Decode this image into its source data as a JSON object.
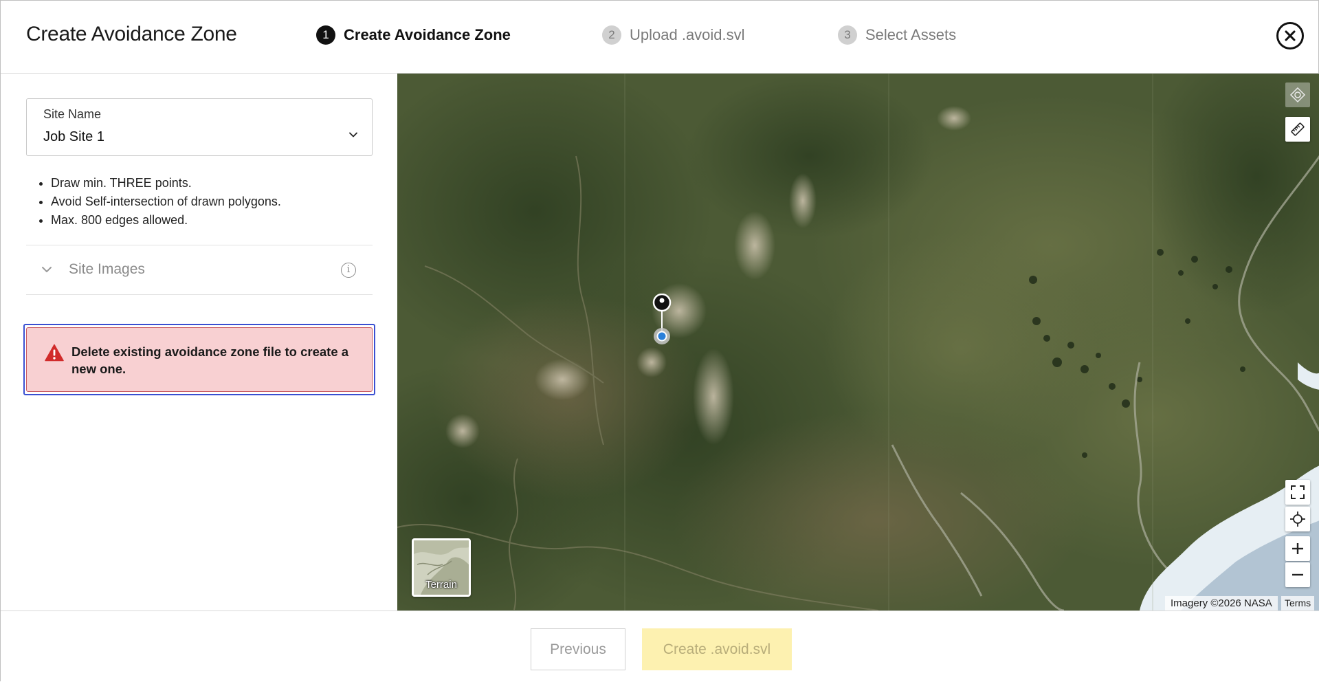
{
  "header": {
    "title": "Create Avoidance Zone",
    "steps": [
      {
        "number": "1",
        "label": "Create Avoidance Zone",
        "state": "active"
      },
      {
        "number": "2",
        "label": "Upload .avoid.svl",
        "state": "inactive"
      },
      {
        "number": "3",
        "label": "Select Assets",
        "state": "inactive"
      }
    ]
  },
  "form": {
    "site_name_label": "Site Name",
    "site_name_value": "Job Site 1",
    "rules": [
      "Draw min. THREE points.",
      "Avoid Self-intersection of drawn polygons.",
      "Max. 800 edges allowed."
    ],
    "site_images_label": "Site Images",
    "alert_text": "Delete existing avoidance zone file to create a new one."
  },
  "map": {
    "terrain_label": "Terrain",
    "attribution": "Imagery ©2026 NASA",
    "terms": "Terms",
    "controls": [
      "satellite-toggle-icon",
      "measure-ruler-icon",
      "fullscreen-icon",
      "recenter-icon",
      "zoom-in-icon",
      "zoom-out-icon"
    ]
  },
  "footer": {
    "previous_label": "Previous",
    "create_label": "Create .avoid.svl"
  },
  "colors": {
    "alert_bg": "#f8d0d2",
    "alert_border": "#c95a62",
    "focus_outline": "#3a4fd1",
    "primary_disabled": "#fdf1b0",
    "alert_icon": "#d12b2b"
  }
}
